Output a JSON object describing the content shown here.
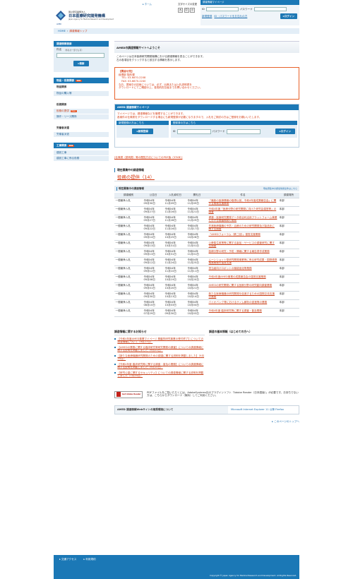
{
  "header": {
    "logo_line1": "国立研究開発法人",
    "logo_line2": "日本医療研究開発機構",
    "logo_en": "Japan Agency for Medical Research and Development",
    "logo_small": "AMED",
    "home_link": "ホーム",
    "font_size_label": "文字サイズの変更",
    "font_sizes": [
      "大",
      "中",
      "小"
    ],
    "mypage_title": "調達情報マイページ",
    "id_label": "ID",
    "password_label": "パスワード",
    "new_register": "新規登録",
    "forgot": "ID・パスワードをお忘れの方",
    "login_button": "ログイン"
  },
  "breadcrumb": {
    "home": "HOME",
    "current": "調達情報トップ"
  },
  "sidebar": {
    "search": {
      "title": "調達情報検索",
      "item_name_label": "件名",
      "item_name_hint": "（件名の一部でも可）",
      "search_button": "検索"
    },
    "groups": [
      {
        "title": "物品・役務関係",
        "badge": "RSS",
        "sub": "物品関係",
        "items": [
          {
            "label": "物品の購入等",
            "new": false
          }
        ]
      },
      {
        "title": "役務関係",
        "badge": "",
        "sub": "",
        "items": [
          {
            "label": "役務の提供",
            "new": true
          },
          {
            "label": "操作・リース関係",
            "new": false
          }
        ]
      },
      {
        "title": "労働者派遣",
        "badge": "",
        "sub": "",
        "items": [
          {
            "label": "労働者派遣",
            "new": false
          }
        ]
      },
      {
        "title": "工事関係",
        "badge": "RSS",
        "sub": "",
        "items": [
          {
            "label": "建設工事",
            "new": false
          },
          {
            "label": "建設工事に係る役務",
            "new": false
          }
        ]
      }
    ]
  },
  "main": {
    "welcome_title": "AMEDの調達情報サイトへようこそ",
    "welcome_text": [
      "このページは日本医療研究開発機構における調達情報を見ることができます。",
      "左の各項目をクリックすると該当する情報を表示します。"
    ],
    "notice": {
      "head": "【問合せ先】",
      "lines": [
        "経理部 契約課",
        "TEL: 03-6870-2208",
        "FAX: 03-6870-2240",
        "なお、提案中の技術については、必ず、出典または入札説明書を",
        "ダウンロードにてご確認の上、各契約担当者までお問い合わせください。"
      ]
    },
    "mypage": {
      "title": "AMED 調達情報マイページ",
      "text1": "マイページでは、調達情報などを管理することができます。",
      "text2": "各案件の仕様書をダウンロードする場合にも新規登録が必要になりますので、入札をご検討の方はご登録をお願いいたします。",
      "new_head": "新規登録の方はこちら",
      "login_head": "登録済の方はこちら",
      "new_button": "新規登録",
      "id_label": "ID",
      "password_label": "パスワード",
      "login_button": "ログイン"
    },
    "pdf_link": "[仕様書（説明書）等の閲覧方法についてのPDF版（37KB）]",
    "current_title": "現在募集中の調達情報",
    "current_count": "役務の提供（14）",
    "current_subhead": "現在募集中の調達情報",
    "current_right": "現在募集中の調達情報全件はこちら",
    "table_headers": [
      "調達種別",
      "公告日",
      "入札締切日",
      "開札日",
      "件名",
      "調達場所"
    ],
    "rows": [
      {
        "kind": "一般競争入札",
        "pub": [
          "令和04年",
          "09月30日"
        ],
        "due": [
          "令和04年",
          "11月09日"
        ],
        "open": [
          "令和04年",
          "11月09日"
        ],
        "title": "「最新の医療情報の取得以前、令和4年度成果報告会」に関する業務支援業務",
        "place": "本部"
      },
      {
        "kind": "一般競争入札",
        "pub": [
          "令和04年",
          "09月27日"
        ],
        "due": [
          "令和04年",
          "11月16日"
        ],
        "open": [
          "令和04年",
          "11月21日"
        ],
        "title": "令和4年度「医療分野の研究開発に向けた研究会運営等」の調査",
        "place": "本部"
      },
      {
        "kind": "一般競争入札",
        "pub": [
          "令和04年",
          "09月27日"
        ],
        "due": [
          "令和04年",
          "11月28日"
        ],
        "open": [
          "令和04年",
          "11月29日"
        ],
        "title": "健康・医療研究開発データ統合利活用プラットフォーム事業における基盤開発の業務",
        "place": "本部"
      },
      {
        "kind": "一般競争入札",
        "pub": [
          "令和04年",
          "09月22日"
        ],
        "due": [
          "令和04年",
          "11月16日"
        ],
        "open": [
          "令和04年",
          "11月17日"
        ],
        "title": "先進医療機器の予防・治療のための研究開発及び製品化に関する調査",
        "place": "本部"
      },
      {
        "kind": "一般競争入札",
        "pub": [
          "令和04年",
          "09月14日"
        ],
        "due": [
          "令和04年",
          "10月25日"
        ],
        "open": [
          "令和04年",
          "10月26日"
        ],
        "title": "「AMEDフォーラム（第二回）」運営支援業務",
        "place": "本部"
      },
      {
        "kind": "一般競争入札",
        "pub": [
          "令和04年",
          "09月13日"
        ],
        "due": [
          "令和04年",
          "10月31日"
        ],
        "open": [
          "令和04年",
          "11月01日"
        ],
        "title": "公衆衛生政策等に関する製品・サービスの調査研究に関する調査",
        "place": "本部"
      },
      {
        "kind": "一般競争入札",
        "pub": [
          "令和04年",
          "09月13日"
        ],
        "due": [
          "令和04年",
          "10月31日"
        ],
        "open": [
          "令和04年",
          "11月01日"
        ],
        "title": "医療分野の研究・予防・情報に関する報告書作成業務",
        "place": "本部"
      },
      {
        "kind": "一般競争入札",
        "pub": [
          "令和04年",
          "09月12日"
        ],
        "due": [
          "令和04年",
          "11月24日"
        ],
        "open": [
          "令和04年",
          "11月25日"
        ],
        "title": "ムーンショット型研究開発事業等に係る研究成果・国際連携推進業務の運営支援",
        "place": "本部"
      },
      {
        "kind": "一般競争入札",
        "pub": [
          "令和04年",
          "09月12日"
        ],
        "due": [
          "令和04年",
          "11月10日"
        ],
        "open": [
          "令和04年",
          "11月11日"
        ],
        "title": "担当者向けロボットの機能強化等業務",
        "place": "本部"
      },
      {
        "kind": "一般競争入札",
        "pub": [
          "令和04年",
          "09月08日"
        ],
        "due": [
          "令和04年",
          "10月19日"
        ],
        "open": [
          "令和04年",
          "10月20日"
        ],
        "title": "令和4年度AMED事業の成果報告会の運営支援業務",
        "place": "本部"
      },
      {
        "kind": "一般競争入札",
        "pub": [
          "令和04年",
          "09月01日"
        ],
        "due": [
          "令和04年",
          "10月20日"
        ],
        "open": [
          "令和04年",
          "10月21日"
        ],
        "title": "AMEDの研究開発に関する医療分野の研究動向調査業務",
        "place": "本部"
      },
      {
        "kind": "一般競争入札",
        "pub": [
          "令和04年",
          "09月30日"
        ],
        "due": [
          "令和04年",
          "10月13日"
        ],
        "open": [
          "令和04年",
          "10月14日"
        ],
        "title": "新たな医療機器の研究開発を促進するための国際交流支援の業務",
        "place": "本部"
      },
      {
        "kind": "一般競争入札",
        "pub": [
          "令和04年",
          "08月10日"
        ],
        "due": [
          "令和04年",
          "10月03日"
        ],
        "open": [
          "令和04年",
          "10月04日"
        ],
        "title": "バイオバンク等におけるゲノム解析の促進等の業務",
        "place": "本部"
      },
      {
        "kind": "一般競争入札",
        "pub": [
          "令和04年",
          "07月29日"
        ],
        "due": [
          "令和04年",
          "09月30日"
        ],
        "open": [
          "令和04年",
          "10月03日"
        ],
        "title": "令和4年度 臨床研究等に関する調査・普及業務",
        "place": "本部"
      }
    ],
    "news_title": "調達情報に関するお知らせ",
    "news": [
      "【令和4年度AMED事業マイページ 基盤的研究事業の受付終了】についての調達情報について（9月27日）",
      "【AMEDの業務に関する臨床研究等研究開発の調査】についての調達情報に関する説明を掲載しました（9月21日）",
      "【新たな医療機器研究開発のための調達に関する説明を掲載しました】（9月20日）",
      "【令和4年度 臨床研究等に関する調査・普及の業務】についての調達情報に関する説明を掲載しました（9月15日）",
      "【研究公募に関するセキュリティ】についての調達情報に関する説明を掲載しました（7月25日）"
    ],
    "basics_title": "調達の基本情報（はじめての方へ）",
    "pdf_note": "PDFファイルをご覧いただくには、AdobeSystems社のプラグインソフト「Adobe Reader（日本語版）」が必要です。お持ちでない方は、こちらからダウンロード（無料）してご利用ください。",
    "adobe_label": "Get Adobe Reader",
    "env_label": "AMED 調達情報Webサイトの推奨環境について",
    "env_value": "Microsoft Internet Explorer 11 以降 Firefox",
    "page_top": "このページのトップへ"
  },
  "footer": {
    "links": [
      "交通アクセス",
      "利用規約"
    ],
    "copyright": "Copyright © Japan Agency for Medical Research and Development. All Rights Reserved."
  }
}
